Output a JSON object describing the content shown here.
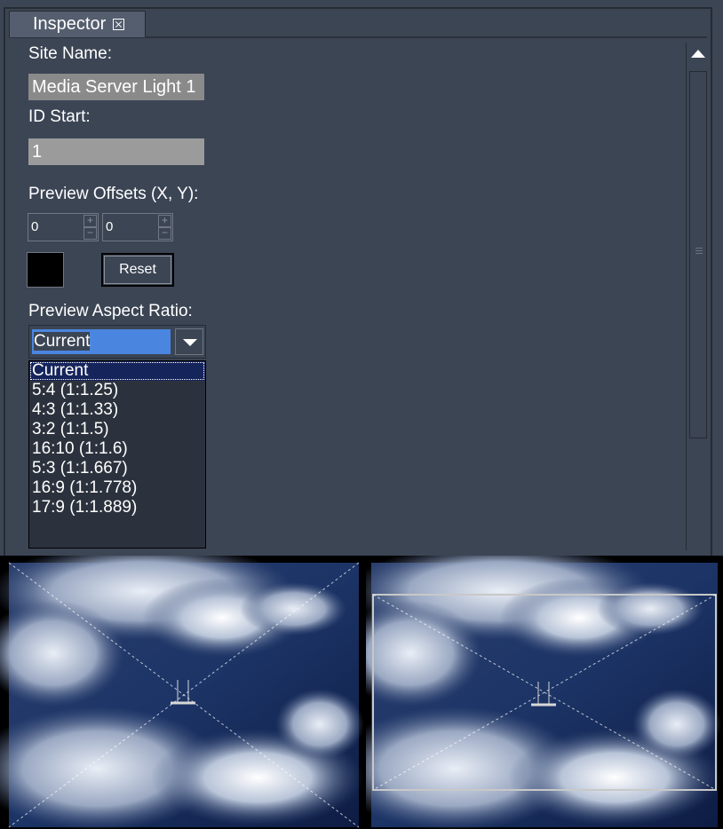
{
  "tab": {
    "label": "Inspector"
  },
  "site_name": {
    "label": "Site Name:",
    "value": "Media Server Light 1"
  },
  "id_start": {
    "label": "ID Start:",
    "value": "1"
  },
  "preview_offsets": {
    "label": "Preview Offsets (X, Y):",
    "x_value": "0",
    "y_value": "0",
    "increment_glyph": "+",
    "decrement_glyph": "−"
  },
  "color_swatch": {
    "color": "#000000"
  },
  "reset_button": {
    "label": "Reset"
  },
  "aspect_ratio": {
    "label": "Preview Aspect Ratio:",
    "selected": "Current",
    "options": [
      "Current",
      "5:4  (1:1.25)",
      "4:3  (1:1.33)",
      "3:2  (1:1.5)",
      "16:10  (1:1.6)",
      "5:3  (1:1.667)",
      "16:9  (1:1.778)",
      "17:9  (1:1.889)"
    ]
  },
  "colors": {
    "panel": "#3c4554",
    "selection": "#4a86e0",
    "list_selected": "#16245c"
  },
  "icons": [
    "close-icon",
    "dropdown-arrow-icon",
    "scroll-up-arrow-icon"
  ],
  "previews": [
    {
      "name": "preview-current",
      "aspect": "Current"
    },
    {
      "name": "preview-letterbox",
      "aspect": "letterboxed"
    }
  ]
}
